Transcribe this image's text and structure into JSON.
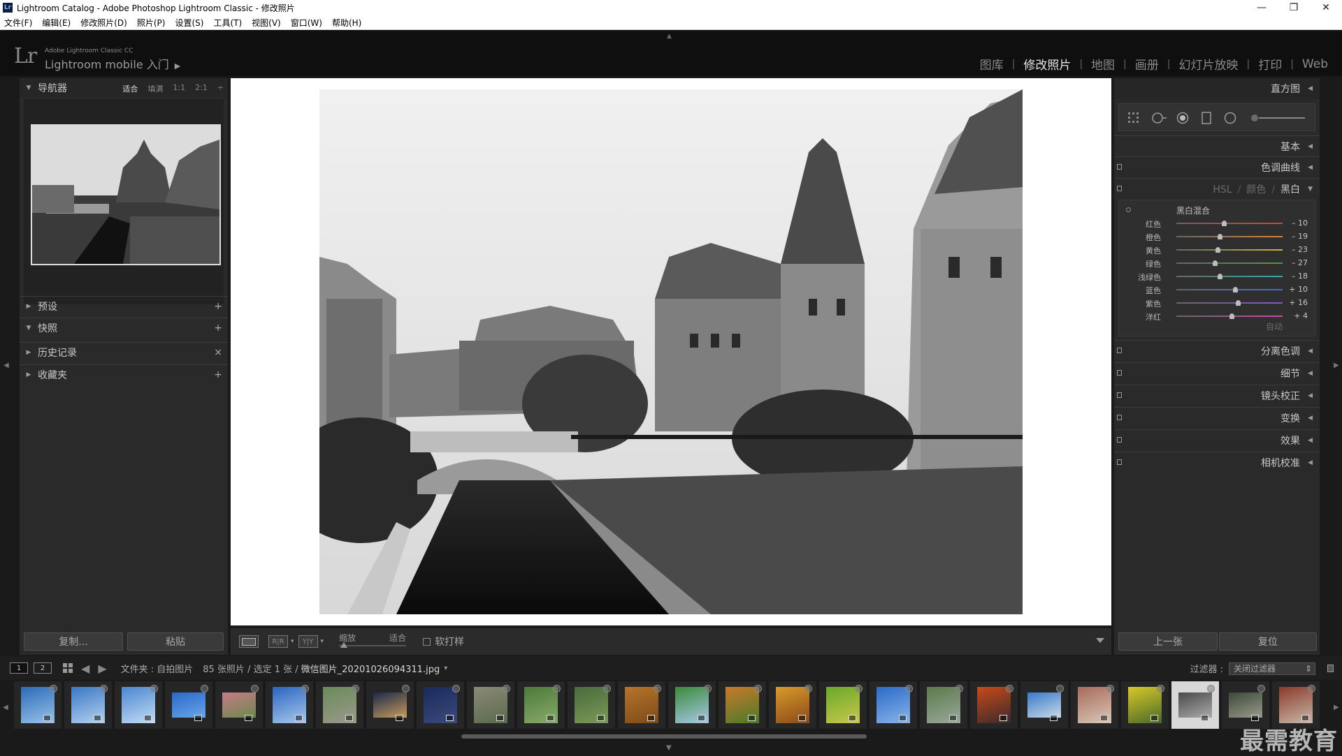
{
  "window": {
    "title": "Lightroom Catalog - Adobe Photoshop Lightroom Classic - 修改照片",
    "app_icon": "Lr",
    "minimize": "—",
    "maximize": "❐",
    "close": "✕"
  },
  "menu": [
    "文件(F)",
    "编辑(E)",
    "修改照片(D)",
    "照片(P)",
    "设置(S)",
    "工具(T)",
    "视图(V)",
    "窗口(W)",
    "帮助(H)"
  ],
  "identity": {
    "logo": "Lr",
    "small": "Adobe Lightroom Classic CC",
    "mobile": "Lightroom mobile 入门",
    "arrow": "▶"
  },
  "modules": [
    {
      "label": "图库",
      "active": false
    },
    {
      "label": "修改照片",
      "active": true
    },
    {
      "label": "地图",
      "active": false
    },
    {
      "label": "画册",
      "active": false
    },
    {
      "label": "幻灯片放映",
      "active": false
    },
    {
      "label": "打印",
      "active": false
    },
    {
      "label": "Web",
      "active": false
    }
  ],
  "left_panel": {
    "navigator": {
      "title": "导航器",
      "zoom": [
        "适合",
        "填满",
        "1:1",
        "2:1"
      ],
      "zoom_active": "适合",
      "zoom_more": "÷"
    },
    "presets": {
      "title": "预设",
      "action": "+"
    },
    "snapshots": {
      "title": "快照",
      "action": "+"
    },
    "history": {
      "title": "历史记录",
      "action": "×"
    },
    "collections": {
      "title": "收藏夹",
      "action": "+"
    },
    "copy_button": "复制...",
    "paste_button": "粘贴"
  },
  "toolbar": {
    "zoom_label": "缩放",
    "fit_label": "适合",
    "before_after_1": "R|R",
    "before_after_2": "Y|Y",
    "soft_proof": "软打样",
    "soft_proof_checked": false
  },
  "right_panel": {
    "histogram": "直方图",
    "basic": "基本",
    "tone_curve": "色调曲线",
    "hsl_tabs": [
      "HSL",
      "颜色",
      "黑白"
    ],
    "hsl_sep": "/",
    "hsl_active": "黑白",
    "bw_mix": {
      "title": "黑白混合",
      "rows": [
        {
          "label": "红色",
          "value": "– 10",
          "num": -10,
          "color": "#c44"
        },
        {
          "label": "橙色",
          "value": "– 19",
          "num": -19,
          "color": "#d8843c"
        },
        {
          "label": "黄色",
          "value": "– 23",
          "num": -23,
          "color": "#c8b43c"
        },
        {
          "label": "绿色",
          "value": "– 27",
          "num": -27,
          "color": "#4a9a4a"
        },
        {
          "label": "浅绿色",
          "value": "– 18",
          "num": -18,
          "color": "#3aa8a8"
        },
        {
          "label": "蓝色",
          "value": "+ 10",
          "num": 10,
          "color": "#4a6ad0"
        },
        {
          "label": "紫色",
          "value": "+ 16",
          "num": 16,
          "color": "#8a54c8"
        },
        {
          "label": "洋红",
          "value": "+ 4",
          "num": 4,
          "color": "#c84aa8"
        }
      ],
      "auto": "自动"
    },
    "split_toning": "分离色调",
    "detail": "细节",
    "lens_corrections": "镜头校正",
    "transform": "变换",
    "effects": "效果",
    "calibration": "相机校准",
    "prev_button": "上一张",
    "reset_button": "复位"
  },
  "filmstrip": {
    "monitor1": "1",
    "monitor2": "2",
    "source": "文件夹 : 自拍图片",
    "count": "85 张照片 / 选定 1 张 /",
    "filename": "微信图片_20201026094311.jpg",
    "file_menu": "▾",
    "filter_label": "过滤器 :",
    "filter_value": "关闭过滤器",
    "filter_arrow": "⇕",
    "watermark": "最需教育",
    "thumbs": [
      {
        "c1": "#2a6ab8",
        "c2": "#9ac2e8",
        "h": 52,
        "sel": false
      },
      {
        "c1": "#3a76c4",
        "c2": "#b4d2f0",
        "h": 52,
        "sel": false
      },
      {
        "c1": "#4a86d0",
        "c2": "#c2dcf4",
        "h": 52,
        "sel": false
      },
      {
        "c1": "#2a68c8",
        "c2": "#6aa4e8",
        "h": 36,
        "sel": false
      },
      {
        "c1": "#c87a8a",
        "c2": "#6a8a4a",
        "h": 36,
        "sel": false
      },
      {
        "c1": "#2a64c0",
        "c2": "#a8c8ec",
        "h": 52,
        "sel": false
      },
      {
        "c1": "#6a8a5a",
        "c2": "#9a9a8a",
        "h": 52,
        "sel": false
      },
      {
        "c1": "#1a2a4a",
        "c2": "#c89a5a",
        "h": 36,
        "sel": false
      },
      {
        "c1": "#1a2a5a",
        "c2": "#3a4a7a",
        "h": 52,
        "sel": false
      },
      {
        "c1": "#8a8a7a",
        "c2": "#5a6a4a",
        "h": 52,
        "sel": false
      },
      {
        "c1": "#4a7a3a",
        "c2": "#8aaa6a",
        "h": 52,
        "sel": false
      },
      {
        "c1": "#4a6a3a",
        "c2": "#7a9a5a",
        "h": 52,
        "sel": false
      },
      {
        "c1": "#b8742a",
        "c2": "#7a4a1a",
        "h": 52,
        "sel": false
      },
      {
        "c1": "#3a8a3a",
        "c2": "#a8c8e8",
        "h": 52,
        "sel": false
      },
      {
        "c1": "#c87a2a",
        "c2": "#4a7a2a",
        "h": 52,
        "sel": false
      },
      {
        "c1": "#d89a2a",
        "c2": "#8a4a1a",
        "h": 52,
        "sel": false
      },
      {
        "c1": "#6aa82a",
        "c2": "#c8c84a",
        "h": 52,
        "sel": false
      },
      {
        "c1": "#2a6ac8",
        "c2": "#8ab4e8",
        "h": 52,
        "sel": false
      },
      {
        "c1": "#5a7a4a",
        "c2": "#9aa89a",
        "h": 52,
        "sel": false
      },
      {
        "c1": "#c84a1a",
        "c2": "#3a2a2a",
        "h": 52,
        "sel": false
      },
      {
        "c1": "#3a7ac8",
        "c2": "#c8d8e8",
        "h": 36,
        "sel": false
      },
      {
        "c1": "#a86a5a",
        "c2": "#d8c8b8",
        "h": 52,
        "sel": false
      },
      {
        "c1": "#d8c82a",
        "c2": "#4a6a2a",
        "h": 52,
        "sel": false
      },
      {
        "c1": "#4a4a4a",
        "c2": "#aaaaaa",
        "h": 36,
        "sel": true
      },
      {
        "c1": "#3a4a3a",
        "c2": "#9a9a8a",
        "h": 36,
        "sel": false
      },
      {
        "c1": "#8a3a2a",
        "c2": "#c8b8a8",
        "h": 52,
        "sel": false
      }
    ]
  }
}
